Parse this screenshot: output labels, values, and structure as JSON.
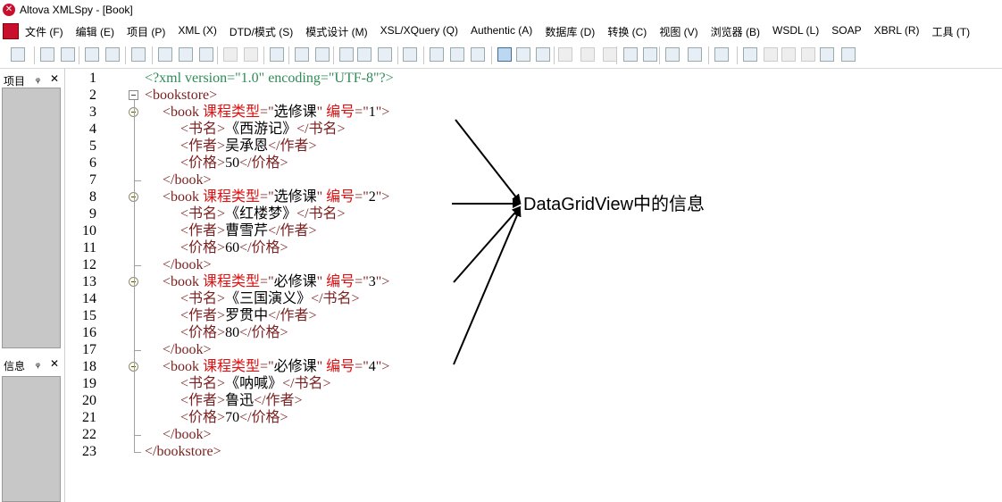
{
  "window": {
    "title": "Altova XMLSpy - [Book]"
  },
  "menu": {
    "items": [
      "文件 (F)",
      "编辑 (E)",
      "项目 (P)",
      "XML (X)",
      "DTD/模式 (S)",
      "模式设计 (M)",
      "XSL/XQuery (Q)",
      "Authentic (A)",
      "数据库 (D)",
      "转换 (C)",
      "视图 (V)",
      "浏览器 (B)",
      "WSDL (L)",
      "SOAP",
      "XBRL (R)",
      "工具 (T)"
    ]
  },
  "panels": {
    "project_title": "项目",
    "info_title": "信息",
    "pin_glyph": "ᵩ",
    "close_glyph": "✕"
  },
  "editor": {
    "line_numbers": [
      "1",
      "2",
      "3",
      "4",
      "5",
      "6",
      "7",
      "8",
      "9",
      "10",
      "11",
      "12",
      "13",
      "14",
      "15",
      "16",
      "17",
      "18",
      "19",
      "20",
      "21",
      "22",
      "23"
    ],
    "pi": "<?xml version=\"1.0\" encoding=\"UTF-8\"?>",
    "books": [
      {
        "type": "选修课",
        "id": "1",
        "name": "《西游记》",
        "author": "吴承恩",
        "price": "50"
      },
      {
        "type": "选修课",
        "id": "2",
        "name": "《红楼梦》",
        "author": "曹雪芹",
        "price": "60"
      },
      {
        "type": "必修课",
        "id": "3",
        "name": "《三国演义》",
        "author": "罗贯中",
        "price": "80"
      },
      {
        "type": "必修课",
        "id": "4",
        "name": "《呐喊》",
        "author": "鲁迅",
        "price": "70"
      }
    ],
    "tags": {
      "bookstore_open": "<bookstore>",
      "bookstore_close": "</bookstore>",
      "book_open": "<book ",
      "book_close": "</book>",
      "attr_type": "课程类型",
      "attr_id": "编号",
      "name_open": "<书名>",
      "name_close": "</书名>",
      "author_open": "<作者>",
      "author_close": "</作者>",
      "price_open": "<价格>",
      "price_close": "</价格>"
    }
  },
  "annotation": {
    "text": "DataGridView中的信息"
  },
  "colors": {
    "tag": "#7a1f1f",
    "attribute": "#dd1111",
    "pi": "#2e8b57",
    "text": "#000000"
  }
}
